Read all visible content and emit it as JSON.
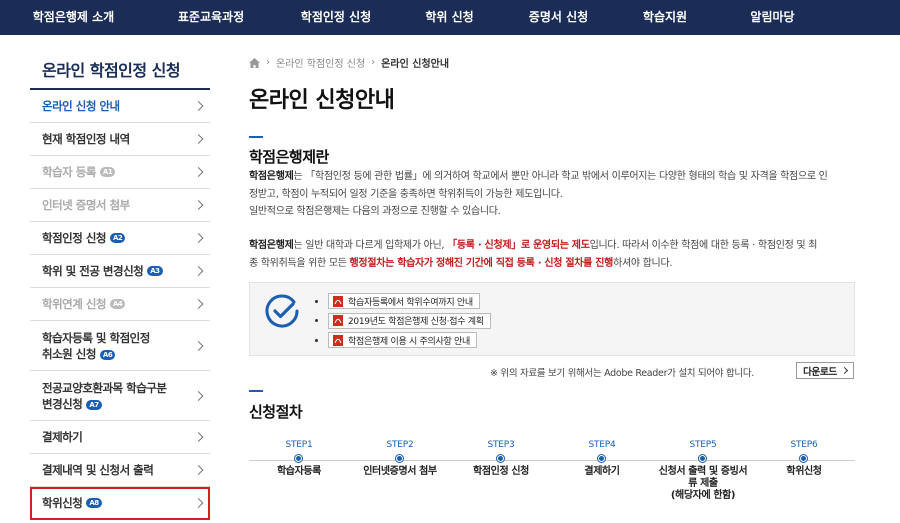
{
  "topnav": [
    "학점은행제 소개",
    "표준교육과정",
    "학점인정 신청",
    "학위 신청",
    "증명서 신청",
    "학습지원",
    "알림마당"
  ],
  "sidebar": {
    "title": "온라인 학점인정 신청",
    "items": [
      {
        "label": "온라인 신청 안내",
        "badge": ""
      },
      {
        "label": "현재 학점인정 내역",
        "badge": ""
      },
      {
        "label": "학습자 등록",
        "badge": "A1"
      },
      {
        "label": "인터넷 증명서 첨부",
        "badge": ""
      },
      {
        "label": "학점인정 신청",
        "badge": "A2"
      },
      {
        "label": "학위 및 전공 변경신청",
        "badge": "A3"
      },
      {
        "label": "학위연계 신청",
        "badge": "A4"
      },
      {
        "label1": "학습자등록 및 학점인정",
        "label2": "취소원 신청",
        "badge": "A6"
      },
      {
        "label1": "전공교양호환과목 학습구분",
        "label2": "변경신청",
        "badge": "A7"
      },
      {
        "label": "결제하기",
        "badge": ""
      },
      {
        "label": "결제내역 및 신청서 출력",
        "badge": ""
      },
      {
        "label": "학위신청",
        "badge": "A8"
      }
    ]
  },
  "breadcrumb": {
    "parent": "온라인 학점인정 신청",
    "current": "온라인 신청안내"
  },
  "page_title": "온라인 신청안내",
  "section1": {
    "title": "학점은행제란",
    "p1_term": "학점은행제",
    "p1_rest": "는 「학점인정 등에 관한 법률」에 의거하여 학교에서 뿐만 아니라 학교 밖에서 이루어지는 다양한 형태의 학습 및 자격을 학점으로 인",
    "p1_line2": "정받고, 학점이 누적되어 일정 기준을 충족하면 학위취득이 가능한 제도입니다.",
    "p1_line3": "일반적으로 학점은행제는 다음의 과정으로 진행할 수 있습니다.",
    "p2_term": "학점은행제",
    "p2_a": "는 일반 대학과 다르게 입학제가 아닌,",
    "p2_red1": "「등록 · 신청제」로 운영되는 제도",
    "p2_b": "입니다. 따라서 이수한 학점에 대한 등록 · 학점인정 및 최",
    "p2_c": "종 학위취득을 위한 모든",
    "p2_red2": "행정절차는 학습자가 정해진 기간에 직접 등록 · 신청 절차를 진행",
    "p2_d": "하셔야 합니다."
  },
  "downloads": [
    "학습자등록에서 학위수여까지 안내",
    "2019년도 학점은행제 신청·접수 계획",
    "학점은행제 이용 시 주의사항 안내"
  ],
  "note": "※ 위의 자료를 보기 위해서는 Adobe Reader가 설치 되어야 합니다.",
  "download_button": "다운로드",
  "section2": {
    "title": "신청절차"
  },
  "steps": [
    {
      "num": "STEP1",
      "l1": "학습자등록",
      "l2": "",
      "l3": ""
    },
    {
      "num": "STEP2",
      "l1": "인터넷증명서 첨부",
      "l2": "",
      "l3": ""
    },
    {
      "num": "STEP3",
      "l1": "학점인정 신청",
      "l2": "",
      "l3": ""
    },
    {
      "num": "STEP4",
      "l1": "결제하기",
      "l2": "",
      "l3": ""
    },
    {
      "num": "STEP5",
      "l1": "신청서 출력 및 증빙서",
      "l2": "류 제출",
      "l3": "(해당자에 한함)"
    },
    {
      "num": "STEP6",
      "l1": "학위신청",
      "l2": "",
      "l3": ""
    }
  ],
  "colors": {
    "nav_bg": "#1b2d57",
    "accent": "#1a5fb4",
    "highlight": "#c41a1a"
  }
}
